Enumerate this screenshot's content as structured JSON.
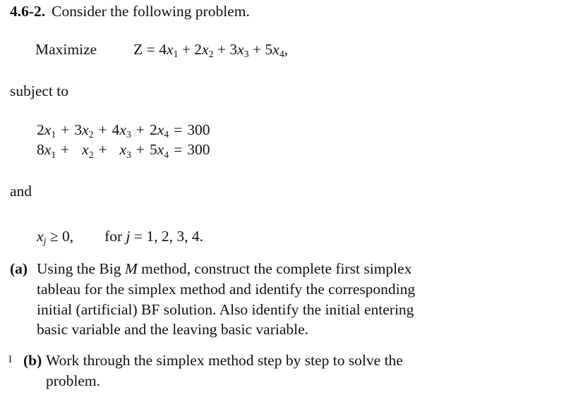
{
  "document": {
    "problem_number": "4.6-2.",
    "statement": "Consider the following problem.",
    "objective": {
      "direction": "Maximize",
      "lhs": "Z",
      "equals": "=",
      "terms": [
        {
          "coefficient": "4",
          "variable": "x",
          "subscript": "1"
        },
        {
          "coefficient": "2",
          "variable": "x",
          "subscript": "2"
        },
        {
          "coefficient": "3",
          "variable": "x",
          "subscript": "3"
        },
        {
          "coefficient": "5",
          "variable": "x",
          "subscript": "4"
        }
      ],
      "operators": [
        "+",
        "+",
        "+"
      ],
      "trailing_comma": ","
    },
    "subject_to_label": "subject to",
    "and_label": "and",
    "constraints": [
      {
        "terms": [
          {
            "coefficient": "2",
            "variable": "x",
            "subscript": "1"
          },
          {
            "coefficient": "3",
            "variable": "x",
            "subscript": "2"
          },
          {
            "coefficient": "4",
            "variable": "x",
            "subscript": "3"
          },
          {
            "coefficient": "2",
            "variable": "x",
            "subscript": "4"
          }
        ],
        "operators": [
          "+",
          "+",
          "+"
        ],
        "relation": "=",
        "rhs": "300"
      },
      {
        "terms": [
          {
            "coefficient": "8",
            "variable": "x",
            "subscript": "1"
          },
          {
            "coefficient": "",
            "variable": "x",
            "subscript": "2"
          },
          {
            "coefficient": "",
            "variable": "x",
            "subscript": "3"
          },
          {
            "coefficient": "5",
            "variable": "x",
            "subscript": "4"
          }
        ],
        "operators": [
          "+",
          "+",
          "+"
        ],
        "relation": "=",
        "rhs": "300"
      }
    ],
    "nonnegativity": {
      "variable": "x",
      "subscript": "j",
      "relation": "≥",
      "value": "0,",
      "qualifier_for": "for",
      "qualifier_index": "j",
      "qualifier_equals": "=",
      "qualifier_values": "1, 2, 3, 4."
    },
    "parts": [
      {
        "tag": "(a)",
        "lines": [
          "Using the Big M method, construct the complete first simplex",
          "tableau for the simplex method and identify the corresponding",
          "initial (artificial) BF solution. Also identify the initial entering",
          "basic variable and the leaving basic variable."
        ],
        "emphasis": "M"
      },
      {
        "tag": "(b)",
        "margin_marker": "I",
        "lines": [
          "Work through the simplex method step by step to solve the",
          "problem."
        ]
      }
    ]
  }
}
